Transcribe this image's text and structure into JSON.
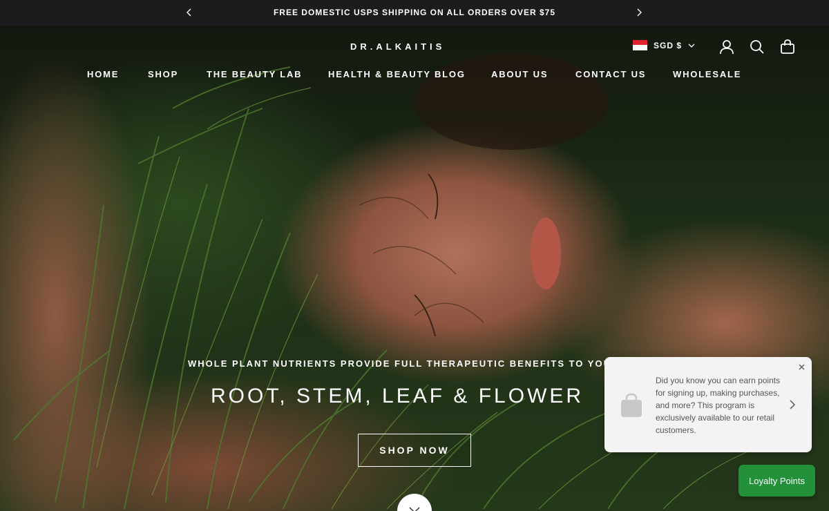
{
  "announcement": {
    "text": "FREE DOMESTIC USPS SHIPPING ON ALL ORDERS OVER $75",
    "prev_icon": "chevron-left-icon",
    "next_icon": "chevron-right-icon"
  },
  "header": {
    "logo": "DR.ALKAITIS",
    "currency": "SGD $",
    "icons": [
      "flag-sg-icon",
      "chevron-down-icon",
      "account-icon",
      "search-icon",
      "bag-icon"
    ]
  },
  "nav": {
    "items": [
      {
        "label": "HOME"
      },
      {
        "label": "SHOP"
      },
      {
        "label": "THE BEAUTY LAB"
      },
      {
        "label": "HEALTH & BEAUTY BLOG"
      },
      {
        "label": "ABOUT US"
      },
      {
        "label": "CONTACT US"
      },
      {
        "label": "WHOLESALE"
      }
    ]
  },
  "hero": {
    "subline": "WHOLE PLANT NUTRIENTS PROVIDE FULL THERAPEUTIC BENEFITS TO YOUR",
    "headline": "ROOT, STEM, LEAF & FLOWER",
    "cta": "SHOP NOW",
    "scroll_icon": "chevron-down-icon"
  },
  "loyalty_popup": {
    "text": "Did you know you can earn points for signing up, making purchases, and more? This program is exclusively available to our retail customers.",
    "icons": [
      "shopping-bag-icon",
      "close-icon",
      "chevron-right-icon"
    ]
  },
  "loyalty_button": {
    "label": "Loyalty Points"
  },
  "colors": {
    "announcement_bg": "#1c1c1c",
    "loyalty_green": "#23903a",
    "popup_bg": "#f3f3f3"
  }
}
